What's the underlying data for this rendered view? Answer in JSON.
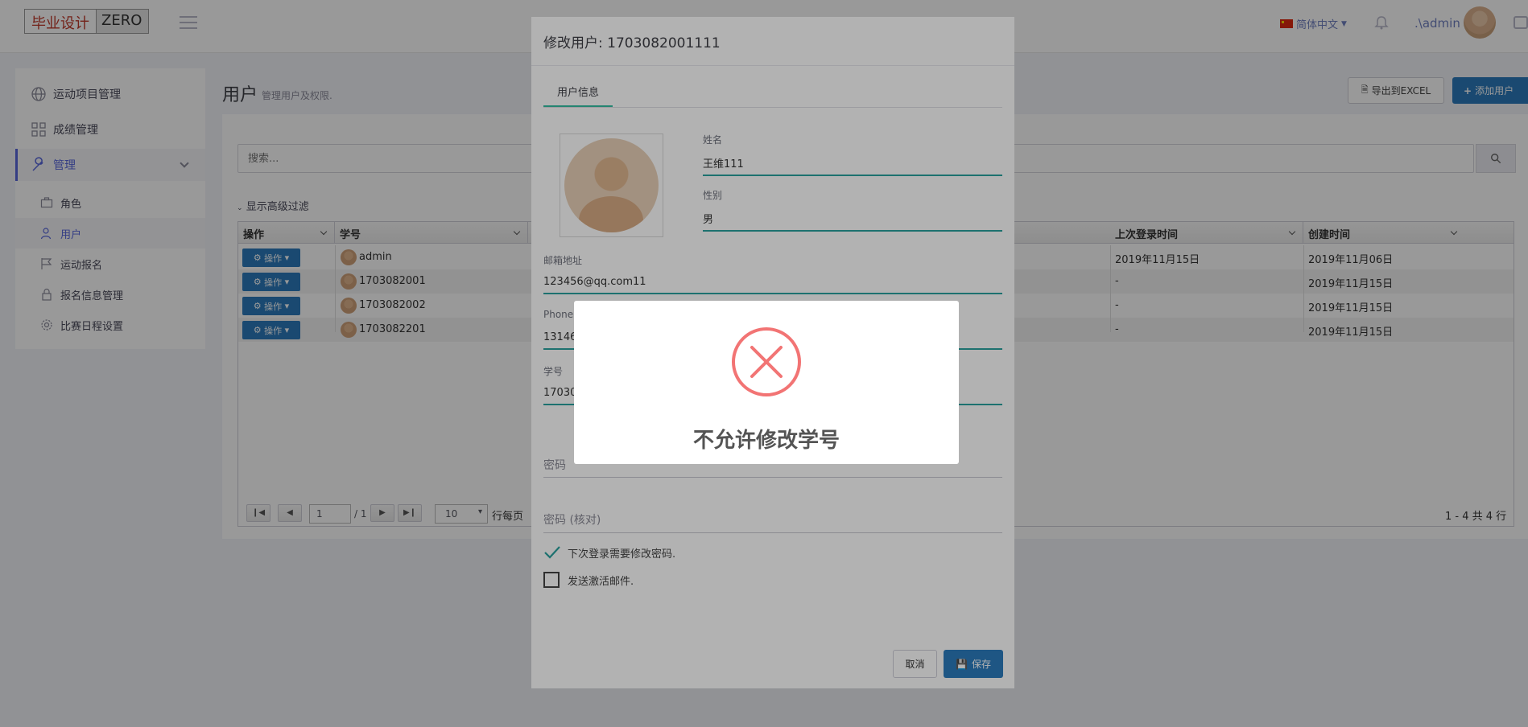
{
  "header": {
    "logo_left": "毕业设计",
    "logo_right": "ZERO",
    "language": "简体中文",
    "user": ".\\admin"
  },
  "sidebar": {
    "items": [
      {
        "label": "运动项目管理",
        "icon": "globe-icon"
      },
      {
        "label": "成绩管理",
        "icon": "grid-icon"
      },
      {
        "label": "管理",
        "icon": "wrench-icon"
      }
    ],
    "subitems": [
      {
        "label": "角色",
        "icon": "briefcase-icon"
      },
      {
        "label": "用户",
        "icon": "users-icon"
      },
      {
        "label": "运动报名",
        "icon": "flag-icon"
      },
      {
        "label": "报名信息管理",
        "icon": "lock-icon"
      },
      {
        "label": "比赛日程设置",
        "icon": "gear-icon"
      }
    ]
  },
  "page": {
    "title": "用户",
    "subtitle": "管理用户及权限.",
    "export_label": "导出到EXCEL",
    "add_label": "添加用户",
    "search_placeholder": "搜索...",
    "advanced_filter": "显示高级过滤"
  },
  "grid": {
    "headers": {
      "op": "操作",
      "student_no": "学号",
      "last_login": "上次登录时间",
      "created": "创建时间"
    },
    "op_button": "操作",
    "rows": [
      {
        "student_no": "admin",
        "last_login": "2019年11月15日",
        "created": "2019年11月06日"
      },
      {
        "student_no": "1703082001",
        "last_login": "-",
        "created": "2019年11月15日"
      },
      {
        "student_no": "1703082002",
        "last_login": "-",
        "created": "2019年11月15日"
      },
      {
        "student_no": "1703082201",
        "last_login": "-",
        "created": "2019年11月15日"
      }
    ],
    "pager": {
      "page": "1",
      "total_pages": "/ 1",
      "page_size": "10",
      "per_page_label": "行每页",
      "summary": "1 - 4 共 4 行"
    }
  },
  "modal": {
    "title": "修改用户: 1703082001111",
    "tab": "用户信息",
    "name_label": "姓名",
    "name_value": "王维111",
    "gender_label": "性别",
    "gender_value": "男",
    "email_label": "邮箱地址",
    "email_value": "123456@qq.com11",
    "phone_label": "Phone",
    "phone_value": "13146",
    "student_label": "学号",
    "student_value": "17030",
    "password_placeholder": "密码",
    "password_confirm_placeholder": "密码 (核对)",
    "must_change_label": "下次登录需要修改密码.",
    "must_change_checked": true,
    "send_email_label": "发送激活邮件.",
    "send_email_checked": false,
    "cancel_label": "取消",
    "save_label": "保存"
  },
  "alert": {
    "message": "不允许修改学号",
    "icon": "error-x-icon",
    "icon_color": "#f27474"
  },
  "colors": {
    "accent": "#2c7bbd",
    "input_underline": "#2aa3a0",
    "sidebar_active": "#5867dd"
  }
}
